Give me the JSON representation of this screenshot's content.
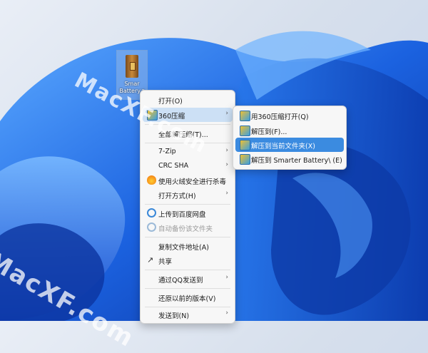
{
  "desktop": {
    "icon_label": "Smar\nBattery.z",
    "watermark_top": "MacXF.com",
    "watermark_bottom": "MacXF.com"
  },
  "context_menu": {
    "items": [
      {
        "label": "打开(O)",
        "icon": "none",
        "submenu": false
      },
      {
        "label": "360压缩",
        "icon": "360-zip-icon",
        "submenu": true
      },
      {
        "label": "全部解压缩(T)...",
        "icon": "none",
        "submenu": false
      },
      {
        "label": "7-Zip",
        "icon": "none",
        "submenu": true
      },
      {
        "label": "CRC SHA",
        "icon": "none",
        "submenu": true
      },
      {
        "label": "使用火绒安全进行杀毒",
        "icon": "huorong-icon",
        "submenu": false
      },
      {
        "label": "打开方式(H)",
        "icon": "none",
        "submenu": true
      },
      {
        "label": "上传到百度网盘",
        "icon": "baidu-cloud-icon",
        "submenu": false
      },
      {
        "label": "自动备份该文件夹",
        "icon": "baidu-cloud-gray-icon",
        "submenu": false
      },
      {
        "label": "复制文件地址(A)",
        "icon": "none",
        "submenu": false
      },
      {
        "label": "共享",
        "icon": "share-icon",
        "submenu": false
      },
      {
        "label": "通过QQ发送到",
        "icon": "none",
        "submenu": true
      },
      {
        "label": "还原以前的版本(V)",
        "icon": "none",
        "submenu": false
      },
      {
        "label": "发送到(N)",
        "icon": "none",
        "submenu": true
      }
    ]
  },
  "submenu_360": {
    "items": [
      {
        "label": "用360压缩打开(Q)"
      },
      {
        "label": "解压到(F)..."
      },
      {
        "label": "解压到当前文件夹(X)"
      },
      {
        "label": "解压到 Smarter Battery\\ (E)"
      }
    ]
  },
  "colors": {
    "wallpaper_blue": "#1a5fd8",
    "highlight": "#cce0f5",
    "active_highlight": "#3b8be0"
  }
}
